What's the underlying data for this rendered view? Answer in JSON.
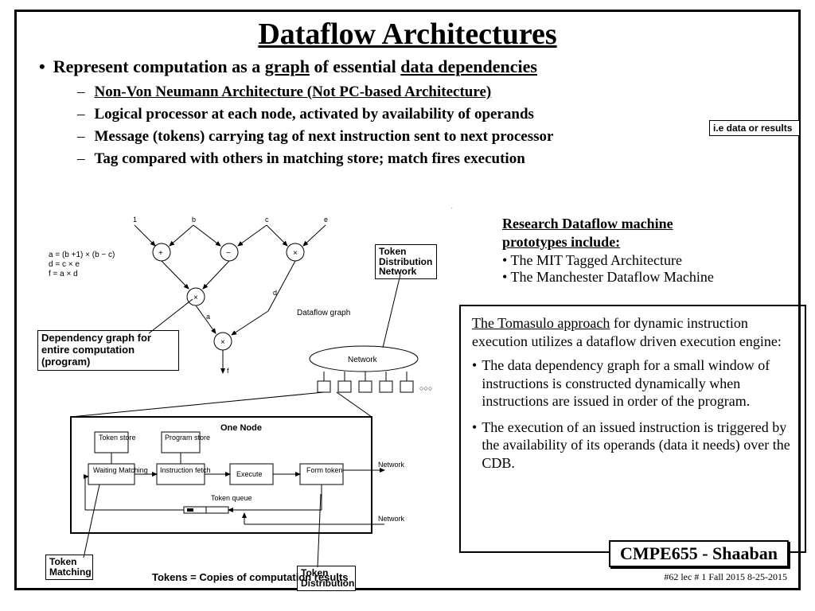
{
  "title": "Dataflow Architectures",
  "main_bullet": {
    "pre": "Represent computation as a ",
    "u1": "graph",
    "mid": " of essential ",
    "u2": "data dependencies"
  },
  "sub_bullets": [
    {
      "underline": true,
      "text": "Non-Von Neumann Architecture (Not PC-based Architecture)"
    },
    {
      "underline": false,
      "text": "Logical processor at each node, activated by availability of operands"
    },
    {
      "underline": false,
      "text": "Message (tokens) carrying tag of next instruction sent to next processor"
    },
    {
      "underline": false,
      "text": "Tag compared with others in matching store; match fires execution"
    }
  ],
  "callouts": {
    "data_results": "i.e data or results",
    "tdn": "Token Distribution Network",
    "depgraph_l1": "Dependency graph for",
    "depgraph_l2": "entire computation (program)",
    "token_match": "Token Matching",
    "token_dist": "Token Distribution"
  },
  "equations": {
    "l1": "a = (b +1) × (b − c)",
    "l2": "d = c × e",
    "l3": "f = a × d"
  },
  "graph_labels": {
    "v1": "1",
    "vb": "b",
    "vc": "c",
    "ve": "e",
    "plus": "+",
    "minus": "−",
    "times": "×",
    "d": "d",
    "a": "a",
    "f": "f",
    "dataflow_graph": "Dataflow graph",
    "network": "Network",
    "dots": "○○○"
  },
  "one_node": {
    "title": "One Node",
    "token_store": "Token store",
    "program_store": "Program store",
    "waiting": "Waiting Matching",
    "ifetch": "Instruction fetch",
    "execute": "Execute",
    "form": "Form token",
    "token_queue": "Token queue",
    "network1": "Network",
    "network2": "Network"
  },
  "research": {
    "hdr_l1": "Research  Dataflow machine",
    "hdr_l2": "prototypes include:",
    "items": [
      "The MIT Tagged Architecture",
      "The Manchester Dataflow Machine"
    ]
  },
  "tomasulo": {
    "lead_u": "The Tomasulo approach",
    "lead_rest": " for dynamic instruction execution utilizes a dataflow driven execution engine:",
    "items": [
      "The data dependency graph  for a small window of instructions is constructed dynamically when instructions are issued in order of the program.",
      "The execution of an issued instruction is triggered by the availability of its operands (data it needs) over the CDB."
    ]
  },
  "tokens_copies": "Tokens = Copies of computation results",
  "course": "CMPE655 - Shaaban",
  "footer": "#62   lec # 1   Fall 2015   8-25-2015"
}
